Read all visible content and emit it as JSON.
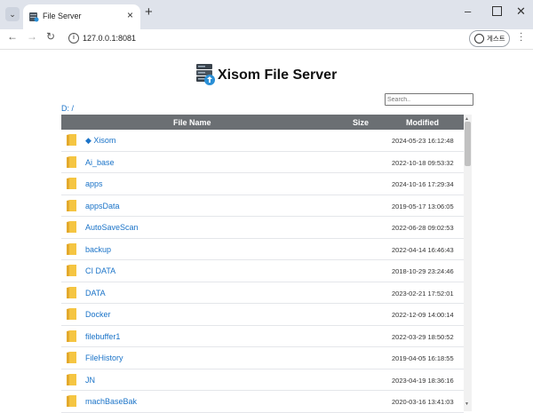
{
  "browser": {
    "tab_title": "File Server",
    "url": "127.0.0.1:8081",
    "profile_label": "게스트"
  },
  "page": {
    "title": "Xisom File Server",
    "search_placeholder": "Search..",
    "path": "D: /"
  },
  "table": {
    "headers": {
      "name": "File Name",
      "size": "Size",
      "modified": "Modified"
    },
    "rows": [
      {
        "name": "◆ Xisom",
        "date": "2024-05-23 16:12:48"
      },
      {
        "name": "Ai_base",
        "date": "2022-10-18 09:53:32"
      },
      {
        "name": "apps",
        "date": "2024-10-16 17:29:34"
      },
      {
        "name": "appsData",
        "date": "2019-05-17 13:06:05"
      },
      {
        "name": "AutoSaveScan",
        "date": "2022-06-28 09:02:53"
      },
      {
        "name": "backup",
        "date": "2022-04-14 16:46:43"
      },
      {
        "name": "CI DATA",
        "date": "2018-10-29 23:24:46"
      },
      {
        "name": "DATA",
        "date": "2023-02-21 17:52:01"
      },
      {
        "name": "Docker",
        "date": "2022-12-09 14:00:14"
      },
      {
        "name": "filebuffer1",
        "date": "2022-03-29 18:50:52"
      },
      {
        "name": "FileHistory",
        "date": "2019-04-05 16:18:55"
      },
      {
        "name": "JN",
        "date": "2023-04-19 18:36:16"
      },
      {
        "name": "machBaseBak",
        "date": "2020-03-16 13:41:03"
      }
    ]
  },
  "colors": {
    "link": "#1a73c8",
    "header_bg": "#6b6f73",
    "folder": "#f5c542",
    "chrome_bg": "#dfe3eb"
  }
}
